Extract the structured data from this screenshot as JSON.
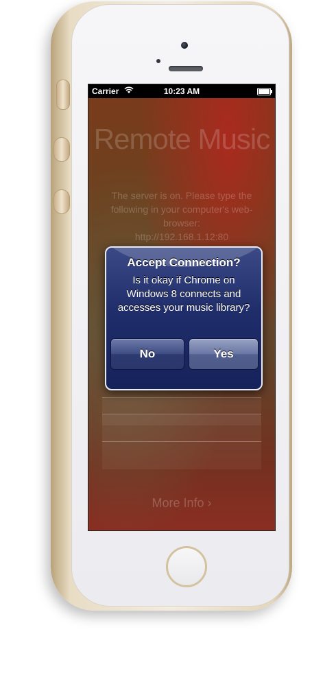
{
  "status_bar": {
    "carrier": "Carrier",
    "time": "10:23 AM",
    "wifi_icon": "wifi-icon",
    "battery_icon": "battery-icon"
  },
  "app": {
    "title": "Remote Music",
    "instructions": "The server is on. Please type the following in your computer's web-browser:",
    "url": "http://192.168.1.12:80",
    "more_info": "More Info ›"
  },
  "alert": {
    "title": "Accept Connection?",
    "message": "Is it okay if Chrome on Windows 8 connects and accesses your music library?",
    "no_label": "No",
    "yes_label": "Yes"
  },
  "colors": {
    "phone_body": "#e8dcc4",
    "alert_background": "#1f2d6b",
    "status_bar": "#000000"
  }
}
